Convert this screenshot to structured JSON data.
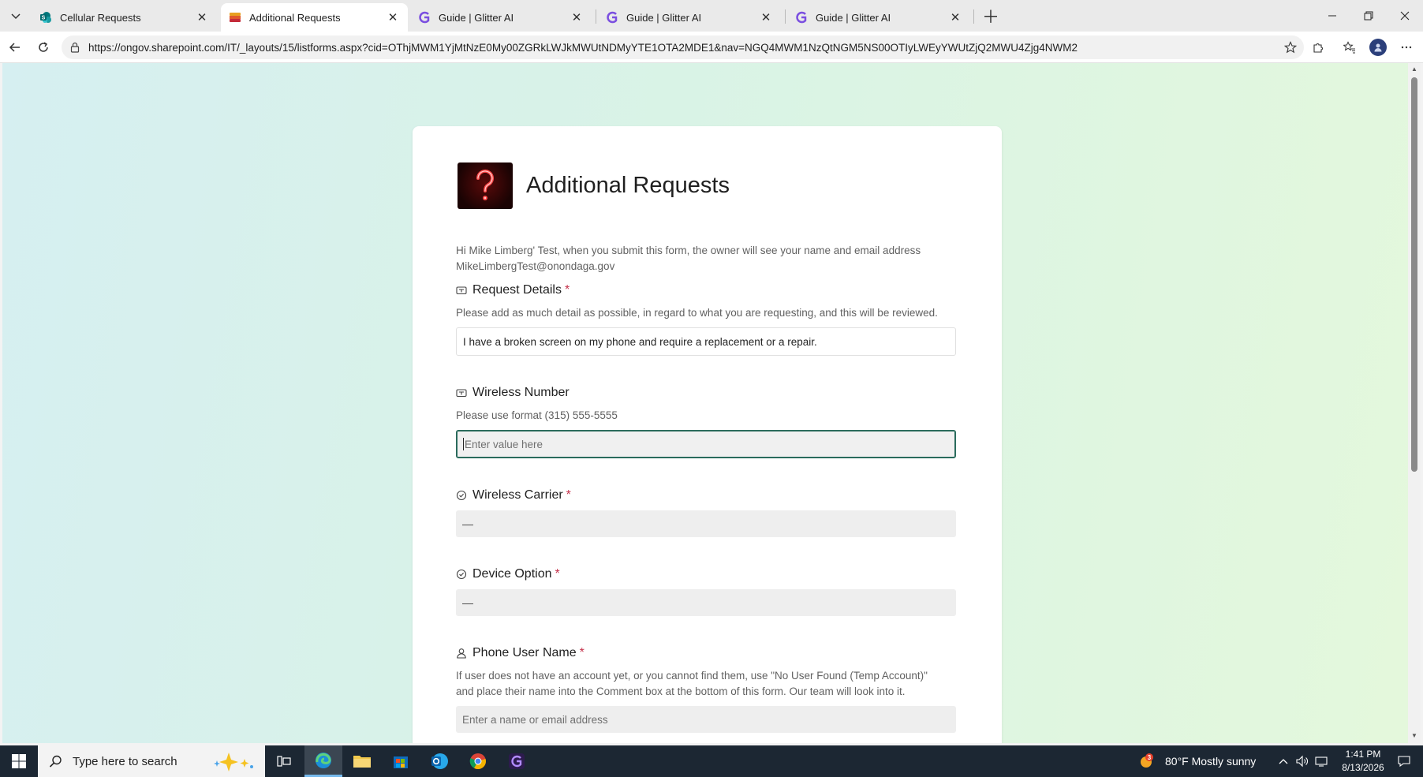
{
  "browser": {
    "tabs": [
      {
        "title": "Cellular Requests",
        "icon": "sharepoint-icon"
      },
      {
        "title": "Additional Requests",
        "icon": "forms-icon",
        "active": true
      },
      {
        "title": "Guide | Glitter AI",
        "icon": "glitter-icon"
      },
      {
        "title": "Guide | Glitter AI",
        "icon": "glitter-icon"
      },
      {
        "title": "Guide | Glitter AI",
        "icon": "glitter-icon"
      }
    ],
    "url": "https://ongov.sharepoint.com/IT/_layouts/15/listforms.aspx?cid=OThjMWM1YjMtNzE0My00ZGRkLWJkMWUtNDMyYTE1OTA2MDE1&nav=NGQ4MWM1NzQtNGM5NS00OTIyLWEyYWUtZjQ2MWU4Zjg4NWM2"
  },
  "form": {
    "title": "Additional Requests",
    "greeting_line1": "Hi Mike Limberg' Test, when you submit this form, the owner will see your name and email address",
    "greeting_line2": "MikeLimbergTest@onondaga.gov",
    "questions": {
      "request_details": {
        "label": "Request Details",
        "required": "*",
        "help": "Please add as much detail as possible, in regard to what you are requesting, and this will be reviewed.",
        "value": "I have a broken screen on my phone and require a replacement or a repair."
      },
      "wireless_number": {
        "label": "Wireless Number",
        "help": "Please use format (315) 555-5555",
        "placeholder": "Enter value here"
      },
      "wireless_carrier": {
        "label": "Wireless Carrier",
        "required": "*",
        "value": "—"
      },
      "device_option": {
        "label": "Device Option",
        "required": "*",
        "value": "—"
      },
      "phone_user_name": {
        "label": "Phone User Name",
        "required": "*",
        "help_line1": "If user does not have an account yet, or you cannot find them, use \"No User Found (Temp Account)\"",
        "help_line2": "and place their name into the Comment box at the bottom of this form. Our team will look into it.",
        "placeholder": "Enter a name or email address"
      }
    }
  },
  "taskbar": {
    "search_placeholder": "Type here to search",
    "weather_badge": "3",
    "weather": "80°F  Mostly sunny",
    "time": "1:41 PM",
    "date": "8/13/2026"
  },
  "colors": {
    "accent": "#2a6b5c",
    "required": "#c4314b",
    "taskbar": "#1c2733"
  }
}
